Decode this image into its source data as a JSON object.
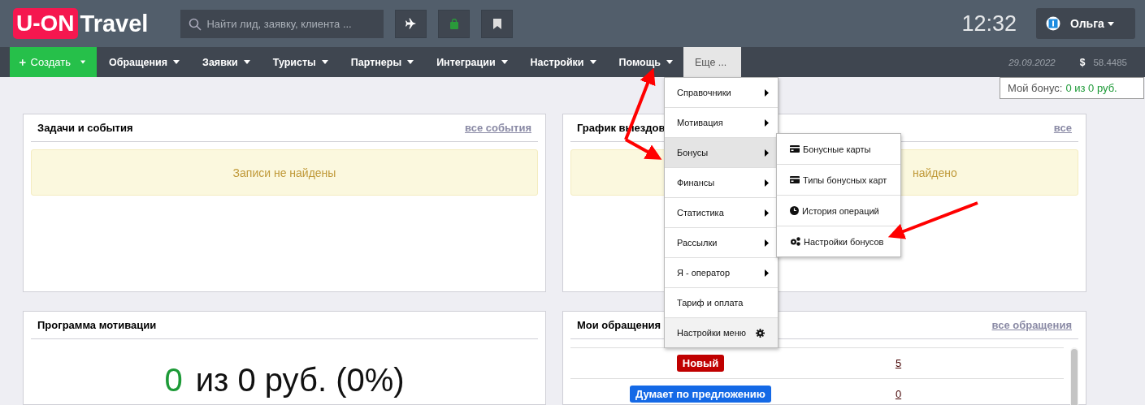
{
  "header": {
    "logo_badge": "U-ON",
    "logo_text": "Travel",
    "search": {
      "placeholder": "Найти лид, заявку, клиента ..."
    },
    "time": "12:32",
    "user": "Ольга"
  },
  "nav": {
    "create": "Создать",
    "items": [
      {
        "label": "Обращения",
        "dropdown": true,
        "selected": false
      },
      {
        "label": "Заявки",
        "dropdown": true,
        "selected": false
      },
      {
        "label": "Туристы",
        "dropdown": true,
        "selected": false
      },
      {
        "label": "Партнеры",
        "dropdown": true,
        "selected": false
      },
      {
        "label": "Интеграции",
        "dropdown": true,
        "selected": false
      },
      {
        "label": "Настройки",
        "dropdown": true,
        "selected": false
      },
      {
        "label": "Помощь",
        "dropdown": true,
        "selected": false
      },
      {
        "label": "Еще ...",
        "dropdown": false,
        "selected": true
      }
    ],
    "date": "29.09.2022",
    "currency_symbol": "$",
    "rate": "58.4485"
  },
  "bonus": {
    "label": "Мой бонус:",
    "value": "0 из 0 руб."
  },
  "menu": {
    "items": [
      {
        "label": "Справочники",
        "kind": "submenu",
        "selected": false
      },
      {
        "label": "Мотивация",
        "kind": "submenu",
        "selected": false
      },
      {
        "label": "Бонусы",
        "kind": "submenu",
        "selected": true
      },
      {
        "label": "Финансы",
        "kind": "submenu",
        "selected": false
      },
      {
        "label": "Статистика",
        "kind": "submenu",
        "selected": false
      },
      {
        "label": "Рассылки",
        "kind": "submenu",
        "selected": false
      },
      {
        "label": "Я - оператор",
        "kind": "submenu",
        "selected": false
      },
      {
        "label": "Тариф и оплата",
        "kind": "plain",
        "selected": false
      },
      {
        "label": "Настройки меню",
        "kind": "settings",
        "selected": false
      }
    ]
  },
  "submenu": {
    "items": [
      {
        "label": "Бонусные карты",
        "kind": "card"
      },
      {
        "label": "Типы бонусных карт",
        "kind": "card"
      },
      {
        "label": "История операций",
        "kind": "clock"
      },
      {
        "label": "Настройки бонусов",
        "kind": "gears"
      }
    ]
  },
  "panels": {
    "tasks": {
      "title": "Задачи и события",
      "link": "все события",
      "empty": "Записи не найдены"
    },
    "schedule": {
      "title": "График выездов",
      "link": "все",
      "empty": "найдено"
    },
    "motivation": {
      "title": "Программа мотивации",
      "amount": "0",
      "rest": "из 0 руб. (0%)"
    },
    "requests": {
      "title": "Мои обращения",
      "link": "все обращения",
      "rows": [
        {
          "status": "Новый",
          "color": "#c00000",
          "count": "5"
        },
        {
          "status": "Думает по предложению",
          "color": "#1469e6",
          "count": "0"
        }
      ]
    }
  }
}
